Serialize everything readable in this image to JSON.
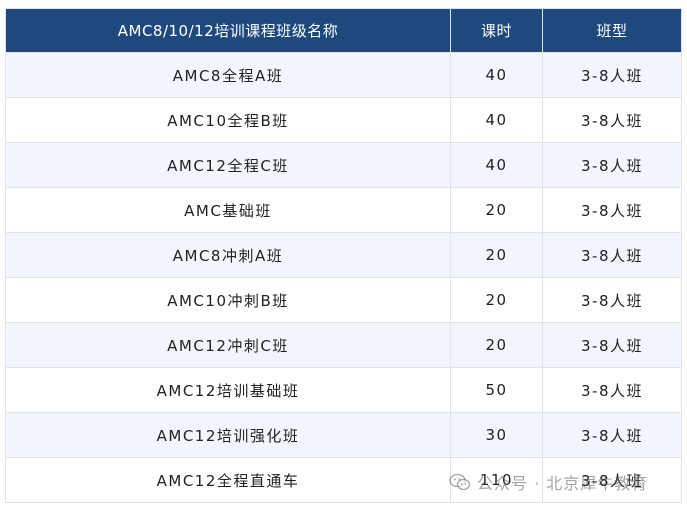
{
  "table": {
    "headers": [
      "AMC8/10/12培训课程班级名称",
      "课时",
      "班型"
    ],
    "rows": [
      [
        "AMC8全程A班",
        "40",
        "3-8人班"
      ],
      [
        "AMC10全程B班",
        "40",
        "3-8人班"
      ],
      [
        "AMC12全程C班",
        "40",
        "3-8人班"
      ],
      [
        "AMC基础班",
        "20",
        "3-8人班"
      ],
      [
        "AMC8冲刺A班",
        "20",
        "3-8人班"
      ],
      [
        "AMC10冲刺B班",
        "20",
        "3-8人班"
      ],
      [
        "AMC12冲刺C班",
        "20",
        "3-8人班"
      ],
      [
        "AMC12培训基础班",
        "50",
        "3-8人班"
      ],
      [
        "AMC12培训强化班",
        "30",
        "3-8人班"
      ],
      [
        "AMC12全程直通车",
        "110",
        "3-8人班"
      ]
    ]
  },
  "watermark": {
    "text": "公众号 · 北京犀牛教育",
    "icon": "wechat-icon"
  }
}
